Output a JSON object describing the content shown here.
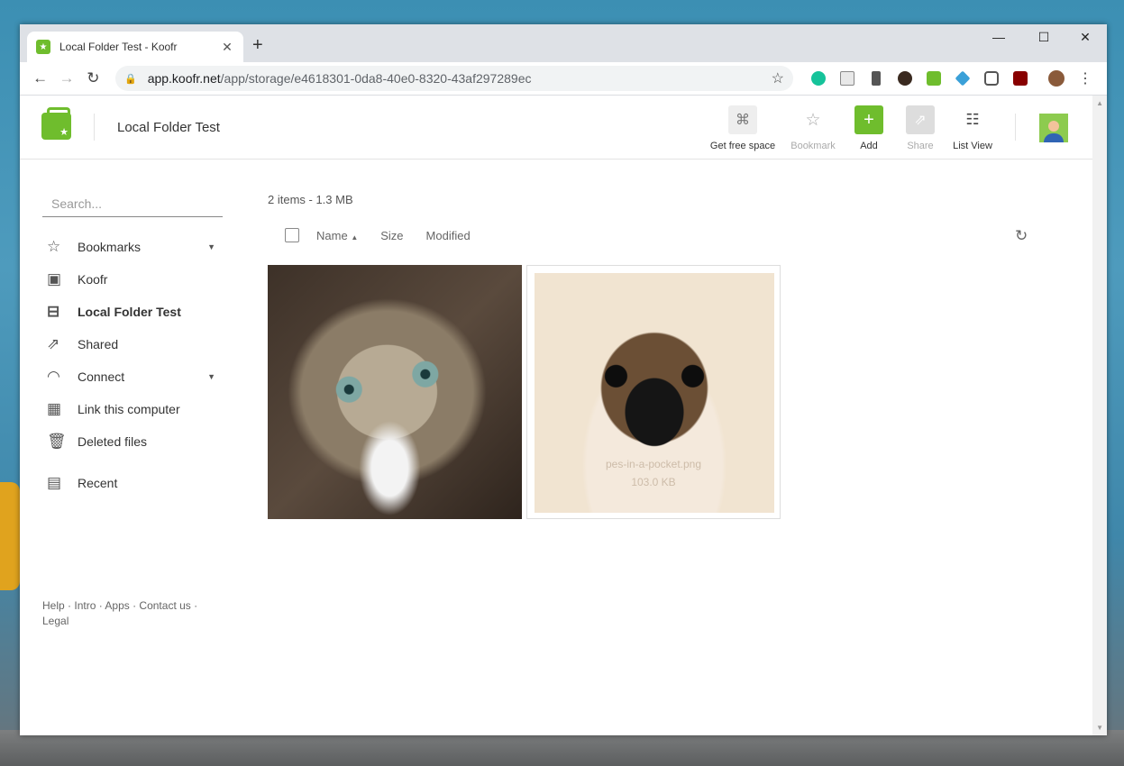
{
  "browser": {
    "tab_title": "Local Folder Test - Koofr",
    "tab_close": "✕",
    "new_tab": "+",
    "url_host": "app.koofr.net",
    "url_path": "/app/storage/e4618301-0da8-40e0-8320-43af297289ec",
    "window_minimize": "—",
    "window_maximize": "☐",
    "window_close": "✕",
    "extensions": [
      "grammarly-icon",
      "reader-icon",
      "eyedropper-icon",
      "k-icon",
      "koofr-icon",
      "buffer-icon",
      "pocket-icon",
      "ublock-icon",
      "profile-avatar"
    ]
  },
  "header": {
    "title": "Local Folder Test",
    "buttons": [
      {
        "label": "Get free space",
        "icon": "gift-icon"
      },
      {
        "label": "Bookmark",
        "icon": "star-icon"
      },
      {
        "label": "Add",
        "icon": "plus-icon"
      },
      {
        "label": "Share",
        "icon": "share-icon"
      },
      {
        "label": "List View",
        "icon": "list-view-icon"
      }
    ]
  },
  "sidebar": {
    "search_placeholder": "Search...",
    "items": [
      {
        "label": "Bookmarks",
        "icon": "☆",
        "caret": true
      },
      {
        "label": "Koofr",
        "icon": "▣"
      },
      {
        "label": "Local Folder Test",
        "icon": "⊟",
        "active": true
      },
      {
        "label": "Shared",
        "icon": "⇗"
      },
      {
        "label": "Connect",
        "icon": "◠",
        "caret": true
      },
      {
        "label": "Link this computer",
        "icon": "▦"
      },
      {
        "label": "Deleted files",
        "icon": "🗑"
      },
      {
        "label": "Recent",
        "icon": "▤"
      }
    ],
    "footer": [
      "Help",
      "Intro",
      "Apps",
      "Contact us",
      "Legal"
    ]
  },
  "main": {
    "summary": "2 items - 1.3 MB",
    "columns": [
      "Name",
      "Size",
      "Modified"
    ],
    "sort_indicator": "▲",
    "files": [
      {
        "name": "cat image",
        "type": "image"
      },
      {
        "name": "pes-in-a-pocket.png",
        "size": "103.0 KB",
        "type": "image"
      }
    ]
  },
  "colors": {
    "accent": "#6fbd2d",
    "text": "#333333"
  }
}
